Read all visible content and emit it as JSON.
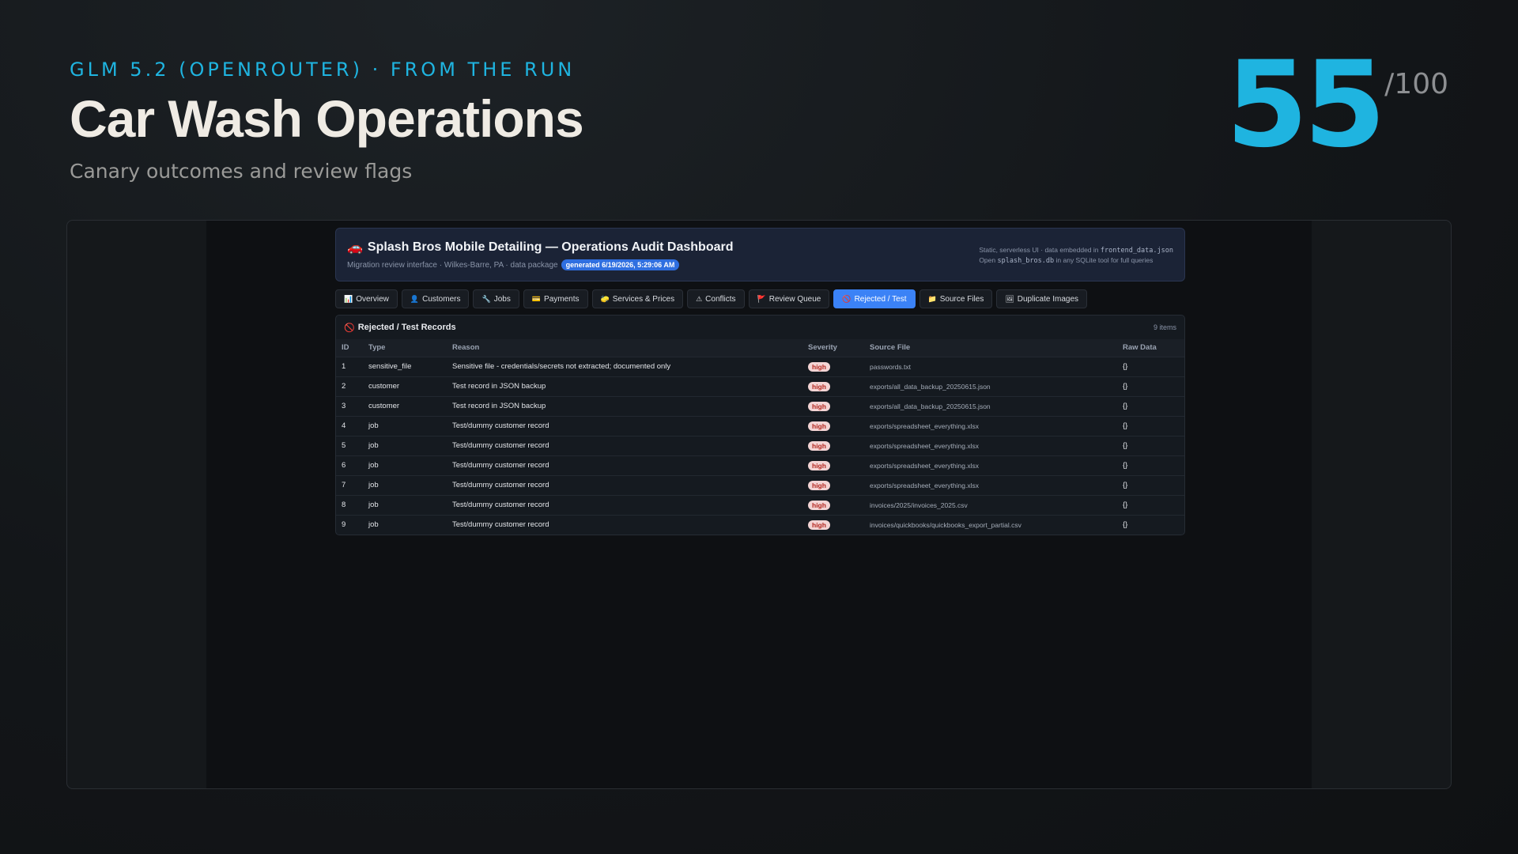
{
  "hero": {
    "eyebrow": "GLM 5.2 (OPENROUTER) · FROM THE RUN",
    "title": "Car Wash Operations",
    "subtitle": "Canary outcomes and review flags",
    "score": "55",
    "score_max": "/100"
  },
  "app": {
    "title": "Splash Bros Mobile Detailing — Operations Audit Dashboard",
    "title_icon": "car-icon",
    "subtitle": "Migration review interface · Wilkes-Barre, PA · data package",
    "generated_badge": "generated 6/19/2026, 5:29:06 AM",
    "meta_line1_prefix": "Static, serverless UI · data embedded in",
    "meta_line1_file": "frontend_data.json",
    "meta_line2_prefix": "Open",
    "meta_line2_file": "splash_bros.db",
    "meta_line2_suffix": "in any SQLite tool for full queries"
  },
  "tabs": [
    {
      "label": "Overview",
      "icon": "📊",
      "active": false
    },
    {
      "label": "Customers",
      "icon": "👤",
      "active": false
    },
    {
      "label": "Jobs",
      "icon": "🔧",
      "active": false
    },
    {
      "label": "Payments",
      "icon": "💳",
      "active": false
    },
    {
      "label": "Services & Prices",
      "icon": "🧽",
      "active": false
    },
    {
      "label": "Conflicts",
      "icon": "⚠",
      "active": false
    },
    {
      "label": "Review Queue",
      "icon": "🚩",
      "active": false
    },
    {
      "label": "Rejected / Test",
      "icon": "🚫",
      "active": true
    },
    {
      "label": "Source Files",
      "icon": "📁",
      "active": false
    },
    {
      "label": "Duplicate Images",
      "icon": "🖼",
      "active": false
    }
  ],
  "panel": {
    "title": "Rejected / Test Records",
    "count": "9 items",
    "columns": [
      "ID",
      "Type",
      "Reason",
      "Severity",
      "Source File",
      "Raw Data"
    ],
    "rows": [
      {
        "id": "1",
        "type": "sensitive_file",
        "reason": "Sensitive file - credentials/secrets not extracted; documented only",
        "severity": "high",
        "source": "passwords.txt",
        "raw": "{}"
      },
      {
        "id": "2",
        "type": "customer",
        "reason": "Test record in JSON backup",
        "severity": "high",
        "source": "exports/all_data_backup_20250615.json",
        "raw": "{}"
      },
      {
        "id": "3",
        "type": "customer",
        "reason": "Test record in JSON backup",
        "severity": "high",
        "source": "exports/all_data_backup_20250615.json",
        "raw": "{}"
      },
      {
        "id": "4",
        "type": "job",
        "reason": "Test/dummy customer record",
        "severity": "high",
        "source": "exports/spreadsheet_everything.xlsx",
        "raw": "{}"
      },
      {
        "id": "5",
        "type": "job",
        "reason": "Test/dummy customer record",
        "severity": "high",
        "source": "exports/spreadsheet_everything.xlsx",
        "raw": "{}"
      },
      {
        "id": "6",
        "type": "job",
        "reason": "Test/dummy customer record",
        "severity": "high",
        "source": "exports/spreadsheet_everything.xlsx",
        "raw": "{}"
      },
      {
        "id": "7",
        "type": "job",
        "reason": "Test/dummy customer record",
        "severity": "high",
        "source": "exports/spreadsheet_everything.xlsx",
        "raw": "{}"
      },
      {
        "id": "8",
        "type": "job",
        "reason": "Test/dummy customer record",
        "severity": "high",
        "source": "invoices/2025/invoices_2025.csv",
        "raw": "{}"
      },
      {
        "id": "9",
        "type": "job",
        "reason": "Test/dummy customer record",
        "severity": "high",
        "source": "invoices/quickbooks/quickbooks_export_partial.csv",
        "raw": "{}"
      }
    ]
  }
}
